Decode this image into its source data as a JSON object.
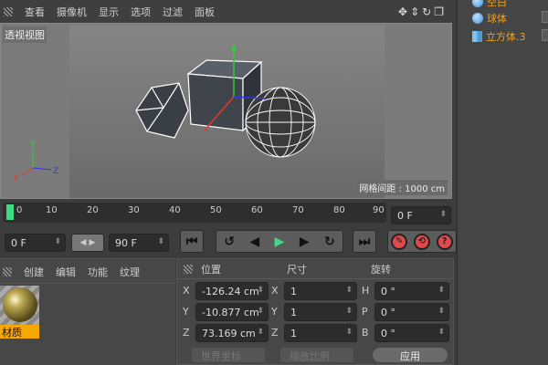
{
  "menu": [
    "查看",
    "摄像机",
    "显示",
    "选项",
    "过滤",
    "面板"
  ],
  "viewport": {
    "label": "透视视图",
    "grid_spacing": "网格间距 : 1000 cm"
  },
  "objects": [
    {
      "name": "空白",
      "icon": "null-icon"
    },
    {
      "name": "球体",
      "icon": "sphere-icon"
    },
    {
      "name": "立方体.3",
      "icon": "cube-icon"
    }
  ],
  "timeline": {
    "ticks": [
      "0",
      "10",
      "20",
      "30",
      "40",
      "50",
      "60",
      "70",
      "80",
      "90"
    ],
    "current_frame": "0 F",
    "playhead": 0
  },
  "controls": {
    "start": "0 F",
    "end": "90 F"
  },
  "materials": {
    "menu": [
      "创建",
      "编辑",
      "功能",
      "纹理"
    ],
    "items": [
      "材质"
    ]
  },
  "coords": {
    "headers": [
      "位置",
      "尺寸",
      "旋转"
    ],
    "rows": [
      {
        "pl": "X",
        "p": "-126.24 cm",
        "sl": "X",
        "s": "1",
        "rl": "H",
        "r": "0 °"
      },
      {
        "pl": "Y",
        "p": "-10.877 cm",
        "sl": "Y",
        "s": "1",
        "rl": "P",
        "r": "0 °"
      },
      {
        "pl": "Z",
        "p": "73.169 cm",
        "sl": "Z",
        "s": "1",
        "rl": "B",
        "r": "0 °"
      }
    ],
    "mode": "世界坐标",
    "scale": "缩放比例",
    "apply": "应用"
  },
  "colors": {
    "accent": "#f0a020",
    "play": "#3ddc84",
    "playhead": "#3ddc84"
  }
}
